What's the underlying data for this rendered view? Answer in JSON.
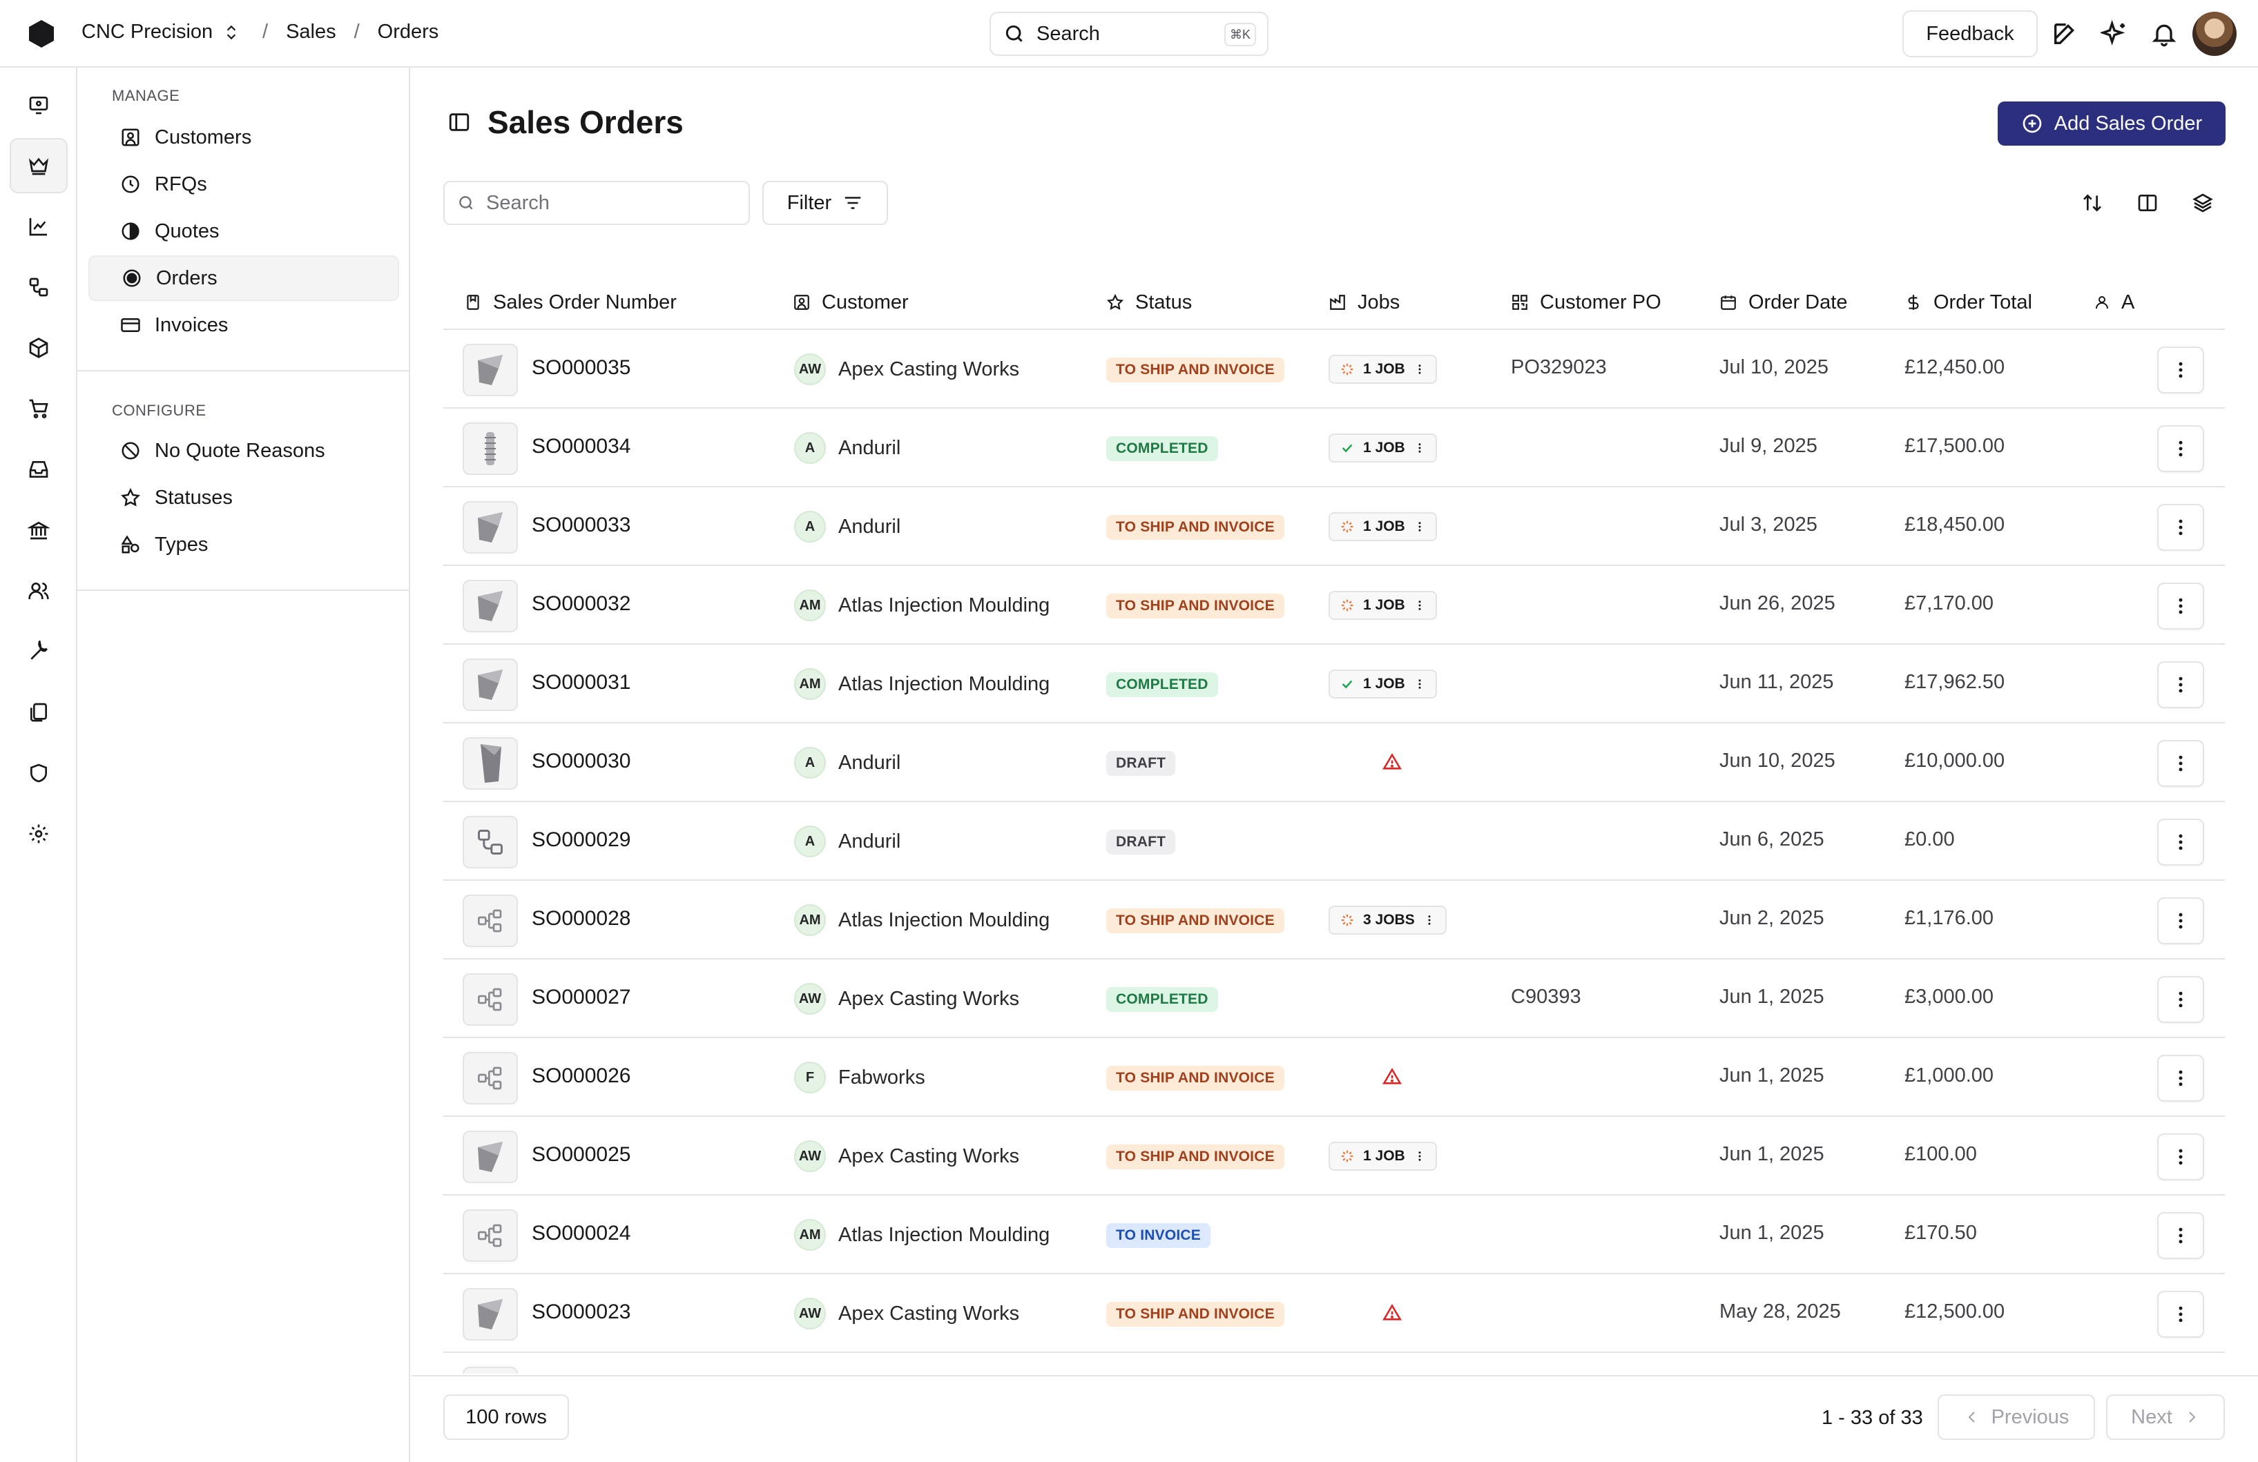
{
  "topbar": {
    "company": "CNC Precision",
    "breadcrumbs": [
      "Sales",
      "Orders"
    ],
    "search_label": "Search",
    "search_shortcut": "⌘K",
    "feedback_label": "Feedback"
  },
  "subnav": {
    "manage_heading": "MANAGE",
    "manage_items": [
      {
        "label": "Customers",
        "icon": "customer-icon"
      },
      {
        "label": "RFQs",
        "icon": "clock-icon"
      },
      {
        "label": "Quotes",
        "icon": "half-circle-icon"
      },
      {
        "label": "Orders",
        "icon": "target-icon",
        "active": true
      },
      {
        "label": "Invoices",
        "icon": "card-icon"
      }
    ],
    "configure_heading": "CONFIGURE",
    "configure_items": [
      {
        "label": "No Quote Reasons",
        "icon": "ban-icon"
      },
      {
        "label": "Statuses",
        "icon": "star-icon"
      },
      {
        "label": "Types",
        "icon": "shapes-icon"
      }
    ]
  },
  "page": {
    "title": "Sales Orders",
    "add_button": "Add Sales Order",
    "search_placeholder": "Search",
    "filter_label": "Filter"
  },
  "table": {
    "columns": [
      "Sales Order Number",
      "Customer",
      "Status",
      "Jobs",
      "Customer PO",
      "Order Date",
      "Order Total",
      "A"
    ],
    "rows": [
      {
        "number": "SO000035",
        "badge": "AW",
        "customer": "Apex Casting Works",
        "status": "TO SHIP AND INVOICE",
        "jobs": "1 JOB",
        "jobs_state": "progress",
        "po": "PO329023",
        "date": "Jul 10, 2025",
        "total": "£12,450.00",
        "thumb": "part"
      },
      {
        "number": "SO000034",
        "badge": "A",
        "customer": "Anduril",
        "status": "COMPLETED",
        "jobs": "1 JOB",
        "jobs_state": "done",
        "po": "",
        "date": "Jul 9, 2025",
        "total": "£17,500.00",
        "thumb": "screw"
      },
      {
        "number": "SO000033",
        "badge": "A",
        "customer": "Anduril",
        "status": "TO SHIP AND INVOICE",
        "jobs": "1 JOB",
        "jobs_state": "progress",
        "po": "",
        "date": "Jul 3, 2025",
        "total": "£18,450.00",
        "thumb": "part"
      },
      {
        "number": "SO000032",
        "badge": "AM",
        "customer": "Atlas Injection Moulding",
        "status": "TO SHIP AND INVOICE",
        "jobs": "1 JOB",
        "jobs_state": "progress",
        "po": "",
        "date": "Jun 26, 2025",
        "total": "£7,170.00",
        "thumb": "part"
      },
      {
        "number": "SO000031",
        "badge": "AM",
        "customer": "Atlas Injection Moulding",
        "status": "COMPLETED",
        "jobs": "1 JOB",
        "jobs_state": "done",
        "po": "",
        "date": "Jun 11, 2025",
        "total": "£17,962.50",
        "thumb": "part"
      },
      {
        "number": "SO000030",
        "badge": "A",
        "customer": "Anduril",
        "status": "DRAFT",
        "jobs": "",
        "jobs_state": "warning",
        "po": "",
        "date": "Jun 10, 2025",
        "total": "£10,000.00",
        "thumb": "bracket"
      },
      {
        "number": "SO000029",
        "badge": "A",
        "customer": "Anduril",
        "status": "DRAFT",
        "jobs": "",
        "jobs_state": "none",
        "po": "",
        "date": "Jun 6, 2025",
        "total": "£0.00",
        "thumb": "assembly"
      },
      {
        "number": "SO000028",
        "badge": "AM",
        "customer": "Atlas Injection Moulding",
        "status": "TO SHIP AND INVOICE",
        "jobs": "3 JOBS",
        "jobs_state": "progress",
        "po": "",
        "date": "Jun 2, 2025",
        "total": "£1,176.00",
        "thumb": "tree"
      },
      {
        "number": "SO000027",
        "badge": "AW",
        "customer": "Apex Casting Works",
        "status": "COMPLETED",
        "jobs": "",
        "jobs_state": "none",
        "po": "C90393",
        "date": "Jun 1, 2025",
        "total": "£3,000.00",
        "thumb": "tree"
      },
      {
        "number": "SO000026",
        "badge": "F",
        "customer": "Fabworks",
        "status": "TO SHIP AND INVOICE",
        "jobs": "",
        "jobs_state": "warning",
        "po": "",
        "date": "Jun 1, 2025",
        "total": "£1,000.00",
        "thumb": "tree"
      },
      {
        "number": "SO000025",
        "badge": "AW",
        "customer": "Apex Casting Works",
        "status": "TO SHIP AND INVOICE",
        "jobs": "1 JOB",
        "jobs_state": "progress",
        "po": "",
        "date": "Jun 1, 2025",
        "total": "£100.00",
        "thumb": "part"
      },
      {
        "number": "SO000024",
        "badge": "AM",
        "customer": "Atlas Injection Moulding",
        "status": "TO INVOICE",
        "jobs": "",
        "jobs_state": "none",
        "po": "",
        "date": "Jun 1, 2025",
        "total": "£170.50",
        "thumb": "tree"
      },
      {
        "number": "SO000023",
        "badge": "AW",
        "customer": "Apex Casting Works",
        "status": "TO SHIP AND INVOICE",
        "jobs": "",
        "jobs_state": "warning",
        "po": "",
        "date": "May 28, 2025",
        "total": "£12,500.00",
        "thumb": "part"
      }
    ]
  },
  "footer": {
    "rows_label": "100 rows",
    "page_info": "1 - 33 of 33",
    "previous_label": "Previous",
    "next_label": "Next"
  },
  "colors": {
    "accent": "#2b2f7e",
    "ship_invoice_bg": "#fdebd8",
    "completed_bg": "#dcf5e5",
    "draft_bg": "#eeeef0",
    "to_invoice_bg": "#dbe8fd",
    "warning": "#dc2626"
  }
}
